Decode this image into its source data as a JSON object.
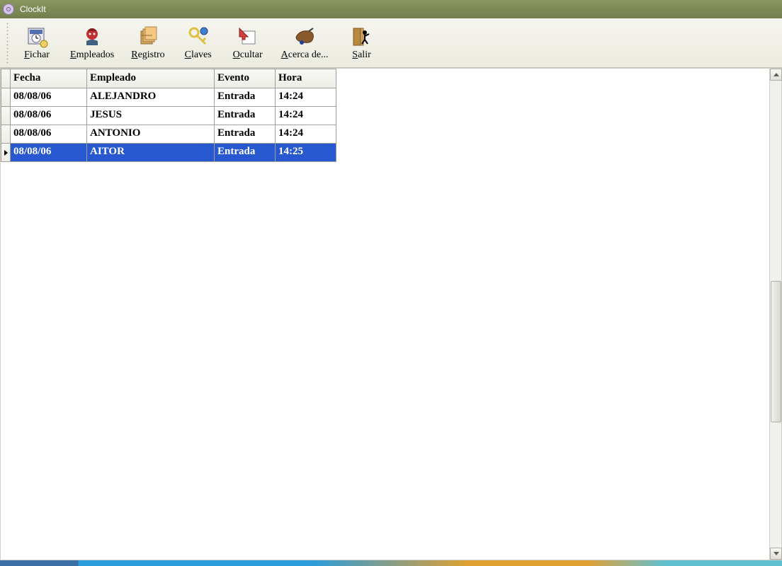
{
  "window": {
    "title": "ClockIt"
  },
  "toolbar": {
    "items": [
      {
        "label": "Fichar",
        "underline_index": 0
      },
      {
        "label": "Empleados",
        "underline_index": 0
      },
      {
        "label": "Registro",
        "underline_index": 0
      },
      {
        "label": "Claves",
        "underline_index": 0
      },
      {
        "label": "Ocultar",
        "underline_index": 0
      },
      {
        "label": "Acerca de...",
        "underline_index": 0
      },
      {
        "label": "Salir",
        "underline_index": 0
      }
    ]
  },
  "grid": {
    "columns": [
      {
        "header": "Fecha"
      },
      {
        "header": "Empleado"
      },
      {
        "header": "Evento"
      },
      {
        "header": "Hora"
      }
    ],
    "rows": [
      {
        "fecha": "08/08/06",
        "empleado": "ALEJANDRO",
        "evento": "Entrada",
        "hora": "14:24",
        "selected": false
      },
      {
        "fecha": "08/08/06",
        "empleado": "JESUS",
        "evento": "Entrada",
        "hora": "14:24",
        "selected": false
      },
      {
        "fecha": "08/08/06",
        "empleado": "ANTONIO",
        "evento": "Entrada",
        "hora": "14:24",
        "selected": false
      },
      {
        "fecha": "08/08/06",
        "empleado": "AITOR",
        "evento": "Entrada",
        "hora": "14:25",
        "selected": true
      }
    ]
  }
}
